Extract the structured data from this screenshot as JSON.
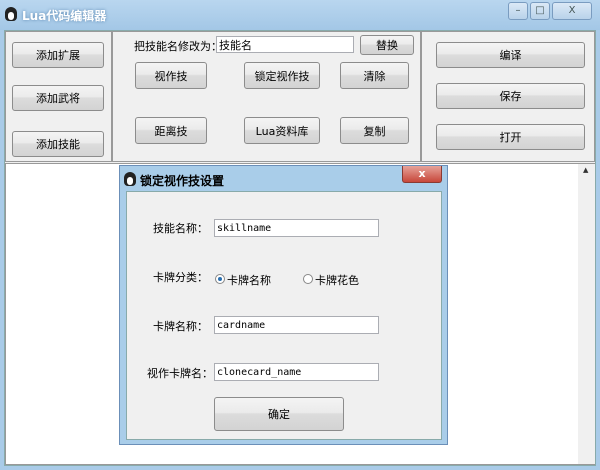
{
  "window": {
    "title": "Lua代码编辑器",
    "minimize": "–",
    "maximize": "□",
    "close": "X"
  },
  "left_buttons": [
    "添加扩展",
    "添加武将",
    "添加技能"
  ],
  "middle": {
    "rename_label": "把技能名修改为：",
    "rename_value": "技能名",
    "replace": "替换",
    "buttons": [
      "视作技",
      "锁定视作技",
      "清除",
      "距离技",
      "Lua资料库",
      "复制"
    ]
  },
  "right_buttons": [
    "编译",
    "保存",
    "打开"
  ],
  "scroll_up": "▲",
  "dialog": {
    "title": "锁定视作技设置",
    "close": "x",
    "skill_name_label": "技能名称：",
    "skill_name_value": "skillname",
    "card_type_label": "卡牌分类：",
    "radio_name": "卡牌名称",
    "radio_suit": "卡牌花色",
    "selected": "卡牌名称",
    "card_name_label": "卡牌名称：",
    "card_name_value": "cardname",
    "clone_label": "视作卡牌名：",
    "clone_value": "clonecard_name",
    "ok": "确定"
  }
}
